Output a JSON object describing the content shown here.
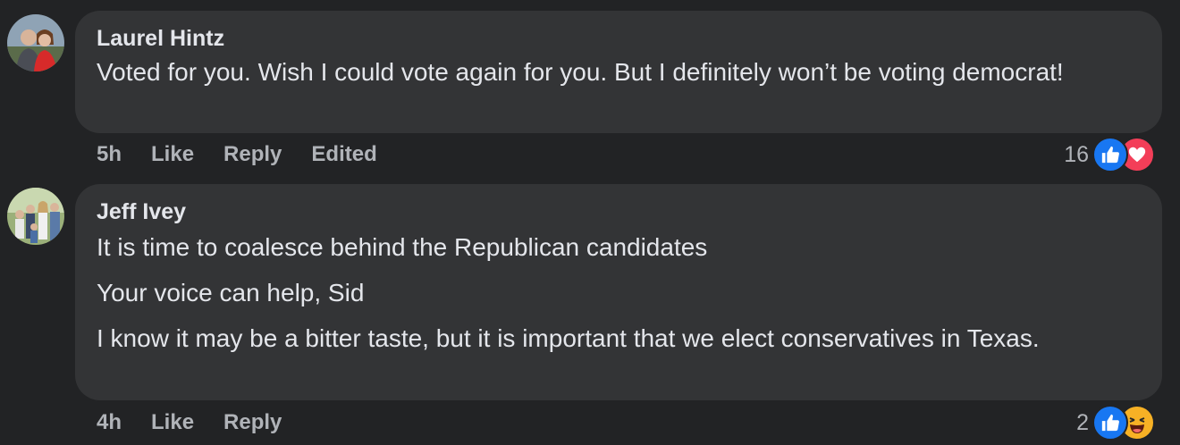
{
  "comments": [
    {
      "author": "Laurel Hintz",
      "paragraphs": [
        "Voted for you. Wish I could vote again for you. But I definitely won’t be voting democrat!"
      ],
      "time": "5h",
      "like": "Like",
      "reply": "Reply",
      "edited": "Edited",
      "reaction_count": "16",
      "reactions": [
        "like-icon",
        "love-icon"
      ]
    },
    {
      "author": "Jeff Ivey",
      "paragraphs": [
        "It is time to coalesce behind the Republican candidates",
        "Your voice can help, Sid",
        "I know it may be a bitter taste, but it is important that we elect conservatives in Texas."
      ],
      "time": "4h",
      "like": "Like",
      "reply": "Reply",
      "reaction_count": "2",
      "reactions": [
        "like-icon",
        "haha-icon"
      ]
    }
  ],
  "colors": {
    "background": "#222325",
    "bubble": "#333436",
    "text": "#e4e6eb",
    "secondary": "#b0b3b8",
    "like": "#1877f2",
    "love": "#f33e58",
    "haha": "#f7b125"
  }
}
